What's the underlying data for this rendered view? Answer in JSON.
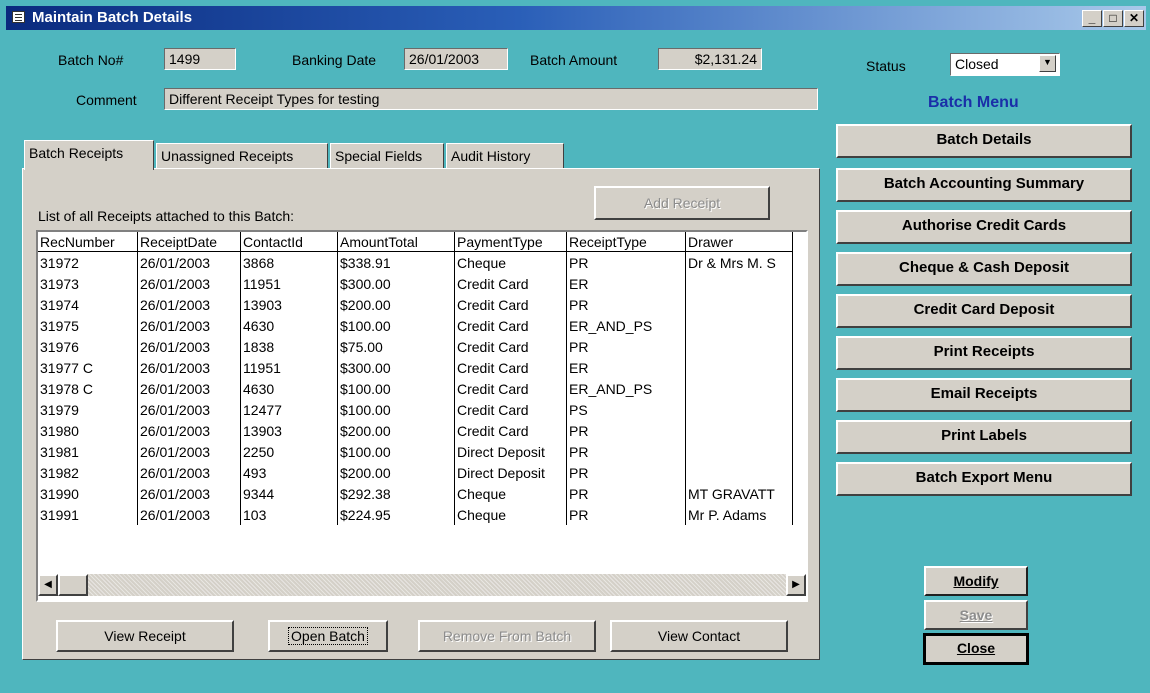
{
  "window": {
    "title": "Maintain Batch Details"
  },
  "header": {
    "batch_no_label": "Batch No#",
    "batch_no": "1499",
    "banking_date_label": "Banking Date",
    "banking_date": "26/01/2003",
    "batch_amount_label": "Batch Amount",
    "batch_amount": "$2,131.24",
    "status_label": "Status",
    "status_value": "Closed",
    "comment_label": "Comment",
    "comment": "Different Receipt Types for testing"
  },
  "tabs": [
    {
      "label": "Batch Receipts"
    },
    {
      "label": "Unassigned Receipts"
    },
    {
      "label": "Special Fields"
    },
    {
      "label": "Audit History"
    }
  ],
  "panel": {
    "add_receipt": "Add Receipt",
    "list_caption": "List of all Receipts attached to this Batch:",
    "columns": [
      "RecNumber",
      "ReceiptDate",
      "ContactId",
      "AmountTotal",
      "PaymentType",
      "ReceiptType",
      "Drawer"
    ],
    "rows": [
      [
        "31972",
        "26/01/2003",
        "3868",
        "$338.91",
        "Cheque",
        "PR",
        "Dr & Mrs M. S"
      ],
      [
        "31973",
        "26/01/2003",
        "11951",
        "$300.00",
        "Credit Card",
        "ER",
        ""
      ],
      [
        "31974",
        "26/01/2003",
        "13903",
        "$200.00",
        "Credit Card",
        "PR",
        ""
      ],
      [
        "31975",
        "26/01/2003",
        "4630",
        "$100.00",
        "Credit Card",
        "ER_AND_PS",
        ""
      ],
      [
        "31976",
        "26/01/2003",
        "1838",
        "$75.00",
        "Credit Card",
        "PR",
        ""
      ],
      [
        "31977 C",
        "26/01/2003",
        "11951",
        "$300.00",
        "Credit Card",
        "ER",
        ""
      ],
      [
        "31978 C",
        "26/01/2003",
        "4630",
        "$100.00",
        "Credit Card",
        "ER_AND_PS",
        ""
      ],
      [
        "31979",
        "26/01/2003",
        "12477",
        "$100.00",
        "Credit Card",
        "PS",
        ""
      ],
      [
        "31980",
        "26/01/2003",
        "13903",
        "$200.00",
        "Credit Card",
        "PR",
        ""
      ],
      [
        "31981",
        "26/01/2003",
        "2250",
        "$100.00",
        "Direct Deposit",
        "PR",
        ""
      ],
      [
        "31982",
        "26/01/2003",
        "493",
        "$200.00",
        "Direct Deposit",
        "PR",
        ""
      ],
      [
        "31990",
        "26/01/2003",
        "9344",
        "$292.38",
        "Cheque",
        "PR",
        "MT GRAVATT"
      ],
      [
        "31991",
        "26/01/2003",
        "103",
        "$224.95",
        "Cheque",
        "PR",
        "Mr P. Adams"
      ]
    ],
    "view_receipt": "View Receipt",
    "open_batch": "Open Batch",
    "remove_from_batch": "Remove From Batch",
    "view_contact": "View Contact"
  },
  "menu": {
    "title": "Batch Menu",
    "items": [
      "Batch Details",
      "Batch Accounting Summary",
      "Authorise Credit Cards",
      "Cheque & Cash Deposit",
      "Credit Card Deposit",
      "Print Receipts",
      "Email Receipts",
      "Print Labels",
      "Batch Export Menu"
    ]
  },
  "actions": {
    "modify": "Modify",
    "save": "Save",
    "close": "Close"
  },
  "colors": {
    "form_bg": "#4fb6be",
    "control_face": "#d4d0c8",
    "menu_title": "#1a2ea8"
  }
}
